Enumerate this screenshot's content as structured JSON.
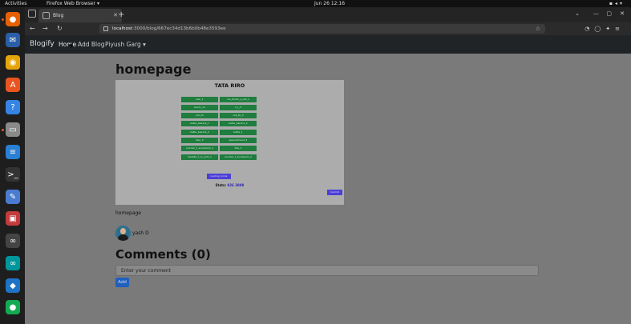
{
  "system_bar": {
    "activities": "Activities",
    "app_name": "Firefox Web Browser ▾",
    "clock": "Jun 26  12:16"
  },
  "dock": {
    "items": [
      {
        "name": "firefox",
        "color": "#e66000",
        "glyph": "●"
      },
      {
        "name": "thunderbird",
        "color": "#2a5fa8",
        "glyph": "✉"
      },
      {
        "name": "rhythmbox",
        "color": "#e5a50a",
        "glyph": "◉"
      },
      {
        "name": "software-center",
        "color": "#e95420",
        "glyph": "A"
      },
      {
        "name": "help",
        "color": "#3584e4",
        "glyph": "?"
      },
      {
        "name": "files",
        "color": "#8a8a8a",
        "glyph": "▭"
      },
      {
        "name": "libreoffice-writer",
        "color": "#2a7fd4",
        "glyph": "≡"
      },
      {
        "name": "terminal",
        "color": "#333333",
        "glyph": ">_"
      },
      {
        "name": "text-editor",
        "color": "#4a7bd0",
        "glyph": "✎"
      },
      {
        "name": "screenshot",
        "color": "#c33b3b",
        "glyph": "▣"
      },
      {
        "name": "infinity-app",
        "color": "#444444",
        "glyph": "∞"
      },
      {
        "name": "arduino",
        "color": "#00979c",
        "glyph": "∞"
      },
      {
        "name": "vscode",
        "color": "#1e73c7",
        "glyph": "◆"
      },
      {
        "name": "mongodb-compass",
        "color": "#13aa52",
        "glyph": "●"
      }
    ]
  },
  "browser": {
    "tab_title": "Blog",
    "url_host": "localhost",
    "url_rest": ":3000/blog/667ec34d13b6b0b48e3593ee"
  },
  "site": {
    "brand": "Blogify",
    "nav_links": [
      "Home",
      "Add Blog",
      "Piyush Garg ▾"
    ]
  },
  "blog": {
    "title": "homepage",
    "cover": {
      "heading": "TATA RIRO",
      "grid_buttons": [
        [
          "kiwi_1",
          "ms_tinder_s_mti_1"
        ],
        [
          "boom_11",
          "k_l_3"
        ],
        [
          "coll_kh",
          "coll_kh_2"
        ],
        [
          "batte_bandra_1",
          "batte_bandra_2"
        ],
        [
          "batte_bandra_3",
          "batte_1"
        ],
        [
          "bhp_3",
          "appointment_3"
        ],
        [
          "coorder_t_sundaram_1",
          "hbs_1"
        ],
        [
          "identity_t_co_amt_1",
          "coorder_t_sundaram_2"
        ]
      ],
      "center_button": "loading_mode",
      "stat_label": "Stats:",
      "stat_value": "026 3808",
      "corner_button": "Submit"
    },
    "caption": "homepage",
    "author": "yash D"
  },
  "comments": {
    "title": "Comments (0)",
    "placeholder": "Enter your comment",
    "add_label": "Add"
  }
}
